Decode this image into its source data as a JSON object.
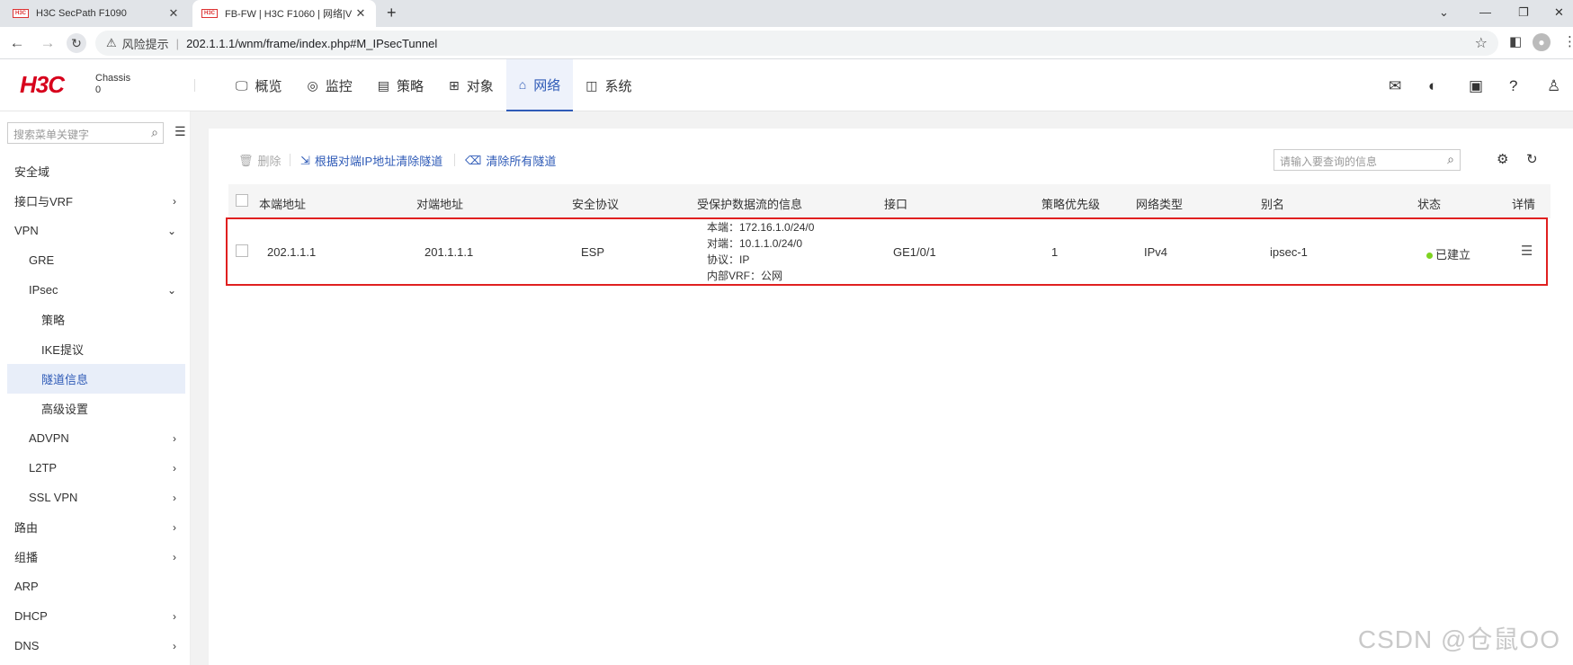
{
  "browser": {
    "tabs": [
      {
        "favicon": "H3C",
        "title": "H3C SecPath F1090"
      },
      {
        "favicon": "H3C",
        "title": "FB-FW | H3C F1060 | 网络|V"
      }
    ],
    "new_tab": "+",
    "address": {
      "risk_label": "风险提示",
      "separator": "|",
      "url": "202.1.1.1/wnm/frame/index.php#M_IPsecTunnel"
    },
    "icons": [
      "back-icon",
      "forward-icon",
      "reload-icon",
      "warning-icon",
      "star-icon",
      "sidepanel-icon",
      "profile-icon",
      "more-icon",
      "minimize-icon",
      "restore-icon",
      "close-icon",
      "chevron-down-icon"
    ]
  },
  "header": {
    "logo": "H3C",
    "chassis_label": "Chassis",
    "chassis_value": "0",
    "menu": [
      {
        "label": "概览",
        "icon": "monitor-icon",
        "active": false
      },
      {
        "label": "监控",
        "icon": "eye-icon",
        "active": false
      },
      {
        "label": "策略",
        "icon": "clipboard-icon",
        "active": false
      },
      {
        "label": "对象",
        "icon": "grid-icon",
        "active": false
      },
      {
        "label": "网络",
        "icon": "network-icon",
        "active": true
      },
      {
        "label": "系统",
        "icon": "system-icon",
        "active": false
      }
    ],
    "right_icons": [
      "mail-icon",
      "palette-icon",
      "save-icon",
      "help-icon",
      "user-icon"
    ]
  },
  "sidebar": {
    "search_placeholder": "搜索菜单关键字",
    "items": [
      {
        "label": "安全域",
        "level": 0,
        "chevron": ""
      },
      {
        "label": "接口与VRF",
        "level": 0,
        "chevron": "›"
      },
      {
        "label": "VPN",
        "level": 0,
        "chevron": "⌄"
      },
      {
        "label": "GRE",
        "level": 1,
        "chevron": ""
      },
      {
        "label": "IPsec",
        "level": 1,
        "chevron": "⌄"
      },
      {
        "label": "策略",
        "level": 2,
        "chevron": ""
      },
      {
        "label": "IKE提议",
        "level": 2,
        "chevron": ""
      },
      {
        "label": "隧道信息",
        "level": 2,
        "chevron": "",
        "active": true
      },
      {
        "label": "高级设置",
        "level": 2,
        "chevron": ""
      },
      {
        "label": "ADVPN",
        "level": 1,
        "chevron": "›"
      },
      {
        "label": "L2TP",
        "level": 1,
        "chevron": "›"
      },
      {
        "label": "SSL VPN",
        "level": 1,
        "chevron": "›"
      },
      {
        "label": "路由",
        "level": 0,
        "chevron": "›"
      },
      {
        "label": "组播",
        "level": 0,
        "chevron": "›"
      },
      {
        "label": "ARP",
        "level": 0,
        "chevron": ""
      },
      {
        "label": "DHCP",
        "level": 0,
        "chevron": "›"
      },
      {
        "label": "DNS",
        "level": 0,
        "chevron": "›"
      }
    ]
  },
  "toolbar": {
    "delete_label": "删除",
    "clear_by_peer_label": "根据对端IP地址清除隧道",
    "clear_all_label": "清除所有隧道",
    "search_placeholder": "请输入要查询的信息"
  },
  "table": {
    "headers": [
      "本端地址",
      "对端地址",
      "安全协议",
      "受保护数据流的信息",
      "接口",
      "策略优先级",
      "网络类型",
      "别名",
      "状态",
      "详情"
    ],
    "rows": [
      {
        "local": "202.1.1.1",
        "peer": "201.1.1.1",
        "protocol": "ESP",
        "flow": [
          "本端：172.16.1.0/24/0",
          "对端：10.1.1.0/24/0",
          "协议：IP",
          "内部VRF：公网"
        ],
        "interface": "GE1/0/1",
        "priority": "1",
        "net_type": "IPv4",
        "alias": "ipsec-1",
        "status": "已建立",
        "status_color": "#7ed321"
      }
    ]
  },
  "colors": {
    "brand": "#d7001c",
    "accent": "#2f5bb7",
    "highlight_border": "#e02020"
  },
  "watermark": "CSDN @仓鼠OO"
}
